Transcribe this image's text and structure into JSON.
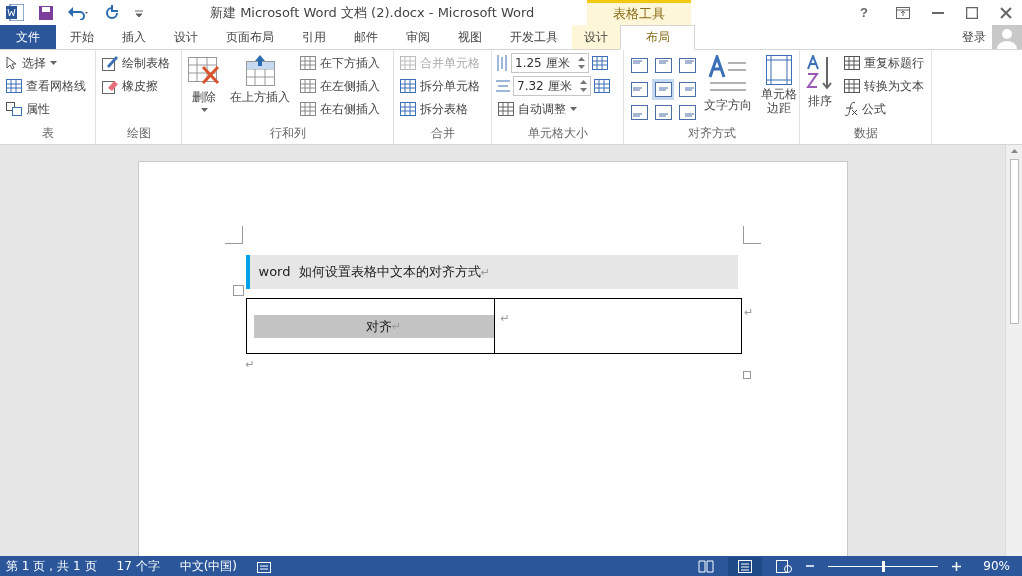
{
  "window": {
    "title": "新建 Microsoft Word 文档 (2).docx - Microsoft Word",
    "context_tab_group": "表格工具",
    "help": "?",
    "sign_in": "登录"
  },
  "tabs": [
    {
      "label": "文件",
      "kind": "file",
      "selected": false
    },
    {
      "label": "开始",
      "kind": "normal",
      "selected": false
    },
    {
      "label": "插入",
      "kind": "normal",
      "selected": false
    },
    {
      "label": "设计",
      "kind": "normal",
      "selected": false
    },
    {
      "label": "页面布局",
      "kind": "normal",
      "selected": false
    },
    {
      "label": "引用",
      "kind": "normal",
      "selected": false
    },
    {
      "label": "邮件",
      "kind": "normal",
      "selected": false
    },
    {
      "label": "审阅",
      "kind": "normal",
      "selected": false
    },
    {
      "label": "视图",
      "kind": "normal",
      "selected": false
    },
    {
      "label": "开发工具",
      "kind": "normal",
      "selected": false
    },
    {
      "label": "设计",
      "kind": "context",
      "selected": false
    },
    {
      "label": "布局",
      "kind": "context",
      "selected": true
    }
  ],
  "ribbon": {
    "table_group": {
      "label": "表",
      "items": [
        {
          "label": "选择",
          "dropdown": true
        },
        {
          "label": "查看网格线",
          "dropdown": false
        },
        {
          "label": "属性",
          "dropdown": false
        }
      ]
    },
    "draw_group": {
      "label": "绘图",
      "items": [
        {
          "label": "绘制表格"
        },
        {
          "label": "橡皮擦"
        }
      ]
    },
    "rows_group": {
      "label": "行和列",
      "delete": "删除",
      "insert_above": "在上方插入",
      "items": [
        {
          "label": "在下方插入"
        },
        {
          "label": "在左侧插入"
        },
        {
          "label": "在右侧插入"
        }
      ]
    },
    "merge_group": {
      "label": "合并",
      "items": [
        {
          "label": "合并单元格",
          "disabled": true
        },
        {
          "label": "拆分单元格",
          "disabled": false
        },
        {
          "label": "拆分表格",
          "disabled": false
        }
      ]
    },
    "size_group": {
      "label": "单元格大小",
      "height": "1.25 厘米",
      "width": "7.32 厘米",
      "autofit": "自动调整"
    },
    "align_group": {
      "label": "对齐方式",
      "cells": [
        {
          "selected": false
        },
        {
          "selected": false
        },
        {
          "selected": false
        },
        {
          "selected": false
        },
        {
          "selected": true
        },
        {
          "selected": false
        },
        {
          "selected": false
        },
        {
          "selected": false
        },
        {
          "selected": false
        }
      ],
      "text_direction": "文字方向",
      "cell_margins": "单元格边距"
    },
    "data_group": {
      "label": "数据",
      "sort": "排序",
      "items": [
        {
          "label": "重复标题行"
        },
        {
          "label": "转换为文本"
        },
        {
          "label": "公式"
        }
      ]
    }
  },
  "document": {
    "heading": "word  如何设置表格中文本的对齐方式",
    "heading_mark": "↵",
    "table": {
      "cells": [
        {
          "text": "对齐",
          "mark": "↵"
        },
        {
          "mark": "↵"
        }
      ],
      "row_end_mark": "↵"
    },
    "after_mark": "↵"
  },
  "status_bar": {
    "page": "第 1 页，共 1 页",
    "words": "17 个字",
    "language": "中文(中国)",
    "zoom": "90%",
    "zoom_slider": {
      "level": 0.5
    }
  }
}
